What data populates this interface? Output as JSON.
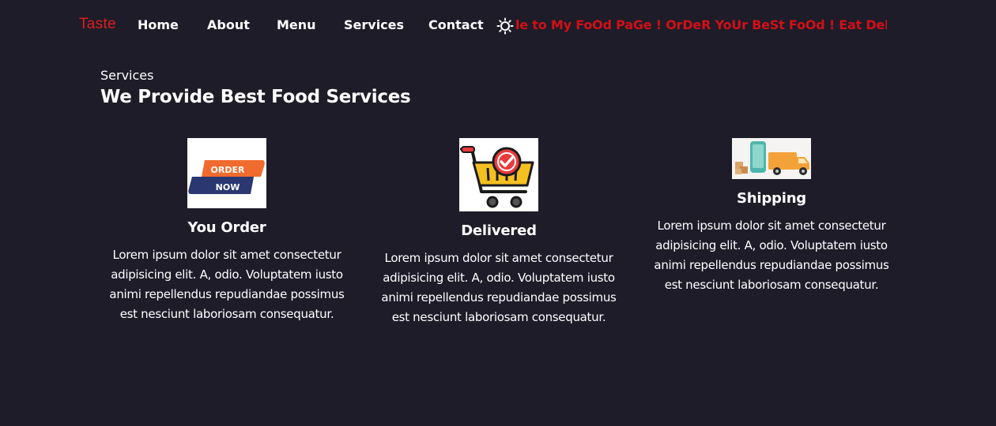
{
  "nav": {
    "brand": "Taste",
    "links": [
      {
        "label": "Home"
      },
      {
        "label": "About"
      },
      {
        "label": "Menu"
      },
      {
        "label": "Services"
      },
      {
        "label": "Contact"
      }
    ],
    "theme_icon": "sun-icon",
    "marquee_text": "le to My FoOd PaGe ! OrDeR YoUr BeSt FoOd ! Eat Delicious"
  },
  "services": {
    "eyebrow": "Services",
    "title": "We Provide Best Food Services",
    "cards": [
      {
        "title": "You Order",
        "image": "order-now-icon",
        "image_text_top": "ORDER",
        "image_text_bottom": "NOW",
        "text": "Lorem ipsum dolor sit amet consectetur adipisicing elit. A, odio. Voluptatem iusto animi repellendus repudiandae possimus est nesciunt laboriosam consequatur."
      },
      {
        "title": "Delivered",
        "image": "shopping-cart-check-icon",
        "text": "Lorem ipsum dolor sit amet consectetur adipisicing elit. A, odio. Voluptatem iusto animi repellendus repudiandae possimus est nesciunt laboriosam consequatur."
      },
      {
        "title": "Shipping",
        "image": "delivery-truck-icon",
        "text": "Lorem ipsum dolor sit amet consectetur adipisicing elit. A, odio. Voluptatem iusto animi repellendus repudiandae possimus est nesciunt laboriosam consequatur."
      }
    ]
  },
  "colors": {
    "background": "#1e1c29",
    "brand": "#e01d1d",
    "marquee": "#d20f16",
    "text": "#ffffff"
  }
}
